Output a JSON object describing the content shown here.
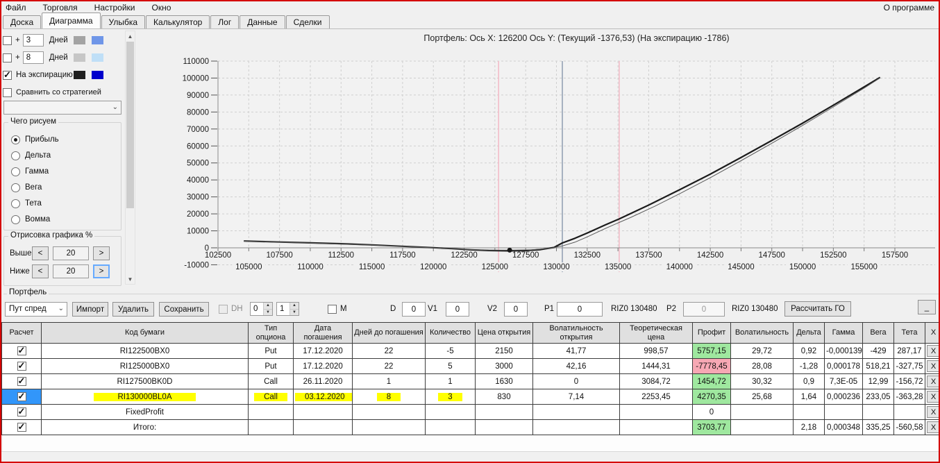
{
  "menu": {
    "items": [
      "Файл",
      "Торговля",
      "Настройки",
      "Окно"
    ],
    "right": "О программе"
  },
  "tabs": {
    "items": [
      "Доска",
      "Диаграмма",
      "Улыбка",
      "Калькулятор",
      "Лог",
      "Данные",
      "Сделки"
    ],
    "active": "Диаграмма"
  },
  "left_panel": {
    "plus_sign": "+",
    "day_rows": [
      {
        "checked": false,
        "value": "3",
        "label": "Дней",
        "swatches": [
          "#a3a3a3",
          "#6f96e8"
        ]
      },
      {
        "checked": false,
        "value": "8",
        "label": "Дней",
        "swatches": [
          "#c6c6c6",
          "#bfdff7"
        ]
      }
    ],
    "expiration": {
      "checked": true,
      "label": "На экспирацию",
      "swatches": [
        "#1f1f1f",
        "#0000cc"
      ]
    },
    "compare": {
      "checked": false,
      "label": "Сравнить со стратегией"
    },
    "strategy_dropdown_value": "",
    "draw_group": {
      "title": "Чего рисуем",
      "options": [
        "Прибыль",
        "Дельта",
        "Гамма",
        "Вега",
        "Тета",
        "Вомма"
      ],
      "selected_index": 0
    },
    "render_group": {
      "title": "Отрисовка графика %",
      "dec_label": "<",
      "inc_label": ">",
      "rows": [
        {
          "label": "Выше",
          "value": "20",
          "focused": false
        },
        {
          "label": "Ниже",
          "value": "20",
          "focused": true
        }
      ]
    }
  },
  "chart_data": {
    "type": "line",
    "title": "Портфель: Ось X: 126200 Ось Y:  (Текущий -1376,53)  (На экспирацию -1786)",
    "xlim": [
      102500,
      157500
    ],
    "ylim": [
      -10000,
      110000
    ],
    "grid": true,
    "y_ticks": [
      110000,
      100000,
      90000,
      80000,
      70000,
      60000,
      50000,
      40000,
      30000,
      20000,
      10000,
      0,
      -10000
    ],
    "x_ticks_row1": [
      102500,
      107500,
      112500,
      117500,
      122500,
      127500,
      132500,
      137500,
      142500,
      147500,
      152500,
      157500
    ],
    "x_ticks_row2": [
      105000,
      110000,
      115000,
      120000,
      125000,
      130000,
      135000,
      140000,
      145000,
      150000,
      155000
    ],
    "vlines": [
      {
        "x": 125300,
        "color": "#f3bcc8",
        "name": "strike-marker-line-1"
      },
      {
        "x": 135100,
        "color": "#f3bcc8",
        "name": "strike-marker-line-2"
      },
      {
        "x": 130480,
        "color": "#94a2b4",
        "name": "current-price-line"
      }
    ],
    "marker": {
      "x": 126200,
      "y": -1376
    },
    "series": [
      {
        "name": "expiration-profit",
        "color": "#1b1b1b",
        "width": 2.2,
        "points": [
          [
            104600,
            4000
          ],
          [
            107500,
            3400
          ],
          [
            110000,
            2900
          ],
          [
            112500,
            2400
          ],
          [
            115000,
            1700
          ],
          [
            117500,
            900
          ],
          [
            120000,
            100
          ],
          [
            121500,
            -500
          ],
          [
            123000,
            -1150
          ],
          [
            124500,
            -1600
          ],
          [
            126200,
            -1786
          ],
          [
            127500,
            -1650
          ],
          [
            128700,
            -1050
          ],
          [
            129800,
            200
          ],
          [
            130480,
            2850
          ],
          [
            131500,
            5600
          ],
          [
            132500,
            8700
          ],
          [
            134000,
            13600
          ],
          [
            135100,
            17000
          ],
          [
            137500,
            25200
          ],
          [
            140000,
            34200
          ],
          [
            142500,
            43400
          ],
          [
            145000,
            53200
          ],
          [
            147500,
            63200
          ],
          [
            150000,
            73400
          ],
          [
            152500,
            84000
          ],
          [
            155000,
            94800
          ],
          [
            156300,
            100400
          ]
        ]
      },
      {
        "name": "current-profit",
        "color": "#5a5a5a",
        "width": 1,
        "points": [
          [
            104600,
            3900
          ],
          [
            110000,
            2800
          ],
          [
            115000,
            1600
          ],
          [
            118000,
            650
          ],
          [
            120000,
            0
          ],
          [
            122000,
            -750
          ],
          [
            124000,
            -1250
          ],
          [
            126200,
            -1376
          ],
          [
            128000,
            -1150
          ],
          [
            129500,
            -300
          ],
          [
            130480,
            1100
          ],
          [
            131500,
            3300
          ],
          [
            132500,
            6400
          ],
          [
            134000,
            11500
          ],
          [
            136000,
            17800
          ],
          [
            138000,
            24500
          ],
          [
            140000,
            31800
          ],
          [
            142500,
            41300
          ],
          [
            145000,
            51300
          ],
          [
            147500,
            61600
          ],
          [
            150000,
            72100
          ],
          [
            152500,
            83000
          ],
          [
            155000,
            94100
          ],
          [
            156300,
            100100
          ]
        ]
      }
    ]
  },
  "portfolio": {
    "title": "Портфель",
    "preset_value": "Пут спред",
    "buttons": [
      "Импорт",
      "Удалить",
      "Сохранить"
    ],
    "dh_label": "DH",
    "spinner1_value": "0",
    "spinner2_value": "1",
    "m_label": "M",
    "d_label": "D",
    "d_value": "0",
    "v1_label": "V1",
    "v1_value": "0",
    "v2_label": "V2",
    "v2_value": "0",
    "p1_label": "P1",
    "p1_value": "0",
    "p1_quote": "RIZ0 130480",
    "p2_label": "P2",
    "p2_value": "0",
    "p2_quote": "RIZ0 130480",
    "calc_button": "Рассчитать ГО",
    "minimize_button": "_"
  },
  "table": {
    "headers": [
      "Расчет",
      "Код бумаги",
      "Тип опциона",
      "Дата погашения",
      "Дней до погашения",
      "Количество",
      "Цена открытия",
      "Волатильность открытия",
      "Теоретическая цена",
      "Профит",
      "Волатильность",
      "Дельта",
      "Гамма",
      "Вега",
      "Тета",
      "X"
    ],
    "x_button_label": "X",
    "rows": [
      {
        "checked": true,
        "selected": false,
        "highlight": false,
        "code": "RI122500BX0",
        "type": "Put",
        "date": "17.12.2020",
        "days": "22",
        "qty": "-5",
        "open_price": "2150",
        "open_vol": "41,77",
        "theor_price": "998,57",
        "profit": "5757,15",
        "profit_state": "pos",
        "vol": "29,72",
        "delta": "0,92",
        "gamma": "-0,000139",
        "vega": "-429",
        "theta": "287,17"
      },
      {
        "checked": true,
        "selected": false,
        "highlight": false,
        "code": "RI125000BX0",
        "type": "Put",
        "date": "17.12.2020",
        "days": "22",
        "qty": "5",
        "open_price": "3000",
        "open_vol": "42,16",
        "theor_price": "1444,31",
        "profit": "-7778,45",
        "profit_state": "neg",
        "vol": "28,08",
        "delta": "-1,28",
        "gamma": "0,000178",
        "vega": "518,21",
        "theta": "-327,75"
      },
      {
        "checked": true,
        "selected": false,
        "highlight": false,
        "code": "RI127500BK0D",
        "type": "Call",
        "date": "26.11.2020",
        "days": "1",
        "qty": "1",
        "open_price": "1630",
        "open_vol": "0",
        "theor_price": "3084,72",
        "profit": "1454,72",
        "profit_state": "pos",
        "vol": "30,32",
        "delta": "0,9",
        "gamma": "7,3E-05",
        "vega": "12,99",
        "theta": "-156,72"
      },
      {
        "checked": true,
        "selected": true,
        "highlight": true,
        "code": "RI130000BL0A",
        "type": "Call",
        "date": "03.12.2020",
        "days": "8",
        "qty": "3",
        "open_price": "830",
        "open_vol": "7,14",
        "theor_price": "2253,45",
        "profit": "4270,35",
        "profit_state": "pos",
        "vol": "25,68",
        "delta": "1,64",
        "gamma": "0,000236",
        "vega": "233,05",
        "theta": "-363,28"
      },
      {
        "checked": true,
        "selected": false,
        "highlight": false,
        "code": "FixedProfit",
        "type": "",
        "date": "",
        "days": "",
        "qty": "",
        "open_price": "",
        "open_vol": "",
        "theor_price": "",
        "profit": "0",
        "profit_state": "none",
        "vol": "",
        "delta": "",
        "gamma": "",
        "vega": "",
        "theta": ""
      },
      {
        "checked": true,
        "selected": false,
        "highlight": false,
        "code": "Итого:",
        "type": "",
        "date": "",
        "days": "",
        "qty": "",
        "open_price": "",
        "open_vol": "",
        "theor_price": "",
        "profit": "3703,77",
        "profit_state": "pos",
        "vol": "",
        "delta": "2,18",
        "gamma": "0,000348",
        "vega": "335,25",
        "theta": "-560,58"
      }
    ]
  },
  "colors": {
    "selection_blue": "#3296fa",
    "profit_positive": "#9fe89f",
    "profit_negative": "#f7a8b4",
    "highlight_yellow": "#ffff00",
    "window_border_red": "#d40000"
  }
}
